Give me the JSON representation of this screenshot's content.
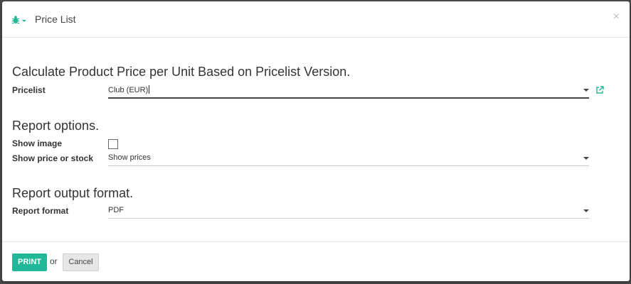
{
  "dialog": {
    "title": "Price List",
    "close_glyph": "×",
    "icons": {
      "debug": "bug-icon",
      "close": "close-icon",
      "external_link": "external-link-icon"
    },
    "accent_color": "#21b799"
  },
  "sections": {
    "pricelist_title": "Calculate Product Price per Unit Based on Pricelist Version.",
    "report_options_title": "Report options.",
    "output_format_title": "Report output format."
  },
  "fields": {
    "pricelist": {
      "label": "Pricelist",
      "value": "Club (EUR)"
    },
    "show_image": {
      "label": "Show image",
      "checked": false
    },
    "show_price_or_stock": {
      "label": "Show price or stock",
      "value": "Show prices"
    },
    "report_format": {
      "label": "Report format",
      "value": "PDF"
    }
  },
  "footer": {
    "print_label": "PRINT",
    "or_text": "or",
    "cancel_label": "Cancel"
  }
}
